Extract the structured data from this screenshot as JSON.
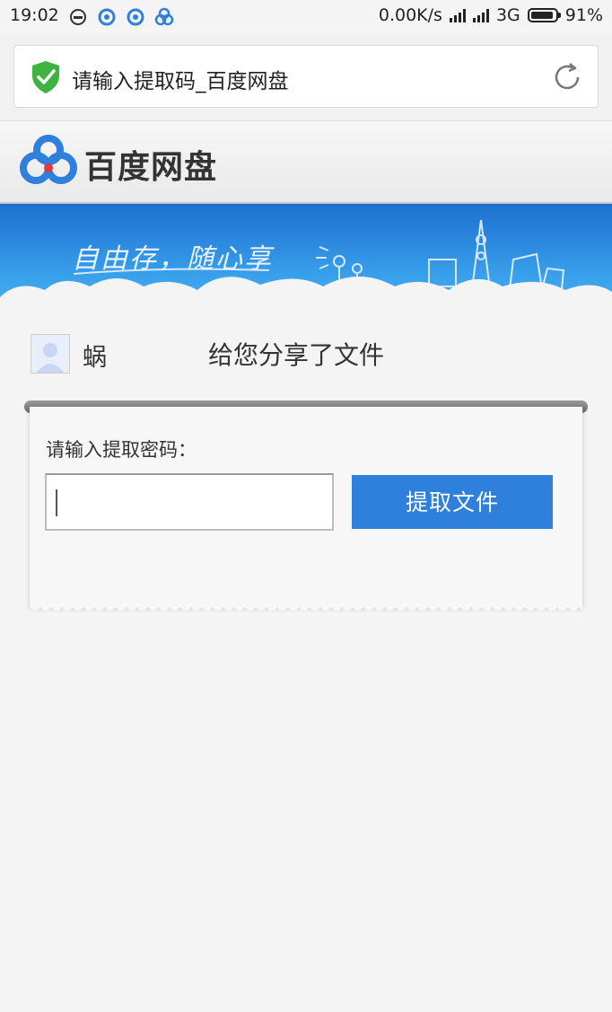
{
  "status_bar": {
    "time": "19:02",
    "net_speed": "0.00K/s",
    "network": "3G",
    "battery": "91%"
  },
  "browser": {
    "page_title": "请输入提取码_百度网盘"
  },
  "brand": {
    "name": "百度网盘"
  },
  "banner": {
    "slogan": "自由存，随心享"
  },
  "share": {
    "sharer_name": "蜗",
    "message": "给您分享了文件"
  },
  "extract": {
    "label": "请输入提取密码：",
    "input_value": "",
    "button_label": "提取文件"
  },
  "colors": {
    "accent": "#2f7fdc",
    "banner": "#2a88e0",
    "secure_green": "#3fb33f"
  }
}
